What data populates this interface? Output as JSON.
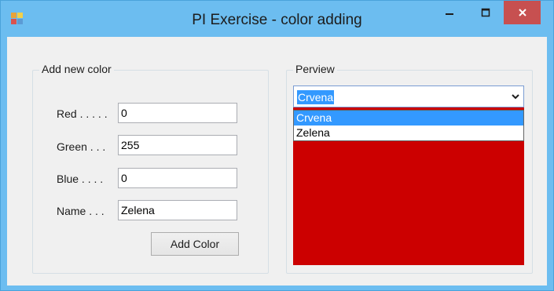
{
  "window": {
    "title": "PI Exercise - color adding",
    "controls": {
      "minimize_icon": "minimize-icon",
      "maximize_icon": "maximize-icon",
      "close_icon": "close-icon"
    }
  },
  "add_group": {
    "title": "Add new color",
    "fields": [
      {
        "label": "Red . . . . .",
        "value": "0"
      },
      {
        "label": "Green . . .",
        "value": "255"
      },
      {
        "label": "Blue  . . . .",
        "value": "0"
      },
      {
        "label": "Name . . .",
        "value": "Zelena"
      }
    ],
    "add_button": "Add Color"
  },
  "preview_group": {
    "title": "Perview",
    "selected": "Crvena",
    "options": [
      "Crvena",
      "Zelena"
    ],
    "highlighted_index": 0,
    "swatch_color": "#cc0000"
  },
  "colors": {
    "titlebar": "#6cbdf0",
    "close_button": "#c75050",
    "selection": "#3399ff"
  }
}
